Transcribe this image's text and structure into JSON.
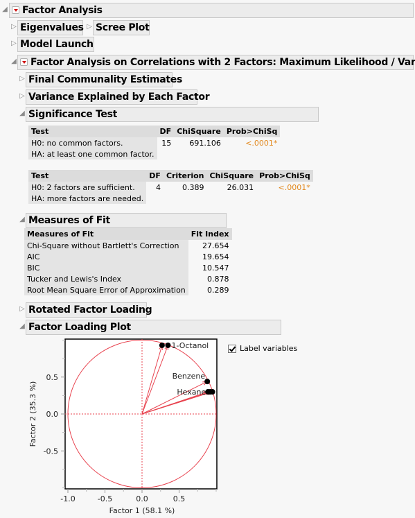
{
  "outline": {
    "root": {
      "title": "Factor Analysis",
      "state": "open"
    },
    "eigenvalues": {
      "title": "Eigenvalues",
      "state": "closed"
    },
    "scree_plot": {
      "title": "Scree Plot",
      "state": "closed"
    },
    "model_launch": {
      "title": "Model Launch",
      "state": "closed"
    },
    "fa_report": {
      "title": "Factor Analysis on Correlations with 2 Factors: Maximum Likelihood / Varimax",
      "state": "open"
    },
    "final_communality": {
      "title": "Final Communality Estimates",
      "state": "closed"
    },
    "variance_explained": {
      "title": "Variance Explained by Each Factor",
      "state": "closed"
    },
    "significance_test": {
      "title": "Significance Test",
      "state": "open"
    },
    "measures_of_fit": {
      "title": "Measures of Fit",
      "state": "open"
    },
    "rotated_loading": {
      "title": "Rotated Factor Loading",
      "state": "closed"
    },
    "loading_plot": {
      "title": "Factor Loading Plot",
      "state": "open"
    }
  },
  "sig_table1": {
    "headers": [
      "Test",
      "DF",
      "ChiSquare",
      "Prob>ChiSq"
    ],
    "rows": [
      {
        "test": "H0: no common factors.",
        "df": "15",
        "chisq": "691.106",
        "prob": "<.0001*"
      },
      {
        "test": "HA: at least one common factor.",
        "df": "",
        "chisq": "",
        "prob": ""
      }
    ]
  },
  "sig_table2": {
    "headers": [
      "Test",
      "DF",
      "Criterion",
      "ChiSquare",
      "Prob>ChiSq"
    ],
    "rows": [
      {
        "test": "H0: 2 factors are sufficient.",
        "df": "4",
        "criterion": "0.389",
        "chisq": "26.031",
        "prob": "<.0001*"
      },
      {
        "test": "HA: more factors are needed.",
        "df": "",
        "criterion": "",
        "chisq": "",
        "prob": ""
      }
    ]
  },
  "fit_table": {
    "headers": [
      "Measures of Fit",
      "Fit Index"
    ],
    "rows": [
      {
        "measure": "Chi-Square without Bartlett's Correction",
        "value": "27.654"
      },
      {
        "measure": "AIC",
        "value": "19.654"
      },
      {
        "measure": "BIC",
        "value": "10.547"
      },
      {
        "measure": "Tucker and Lewis's Index",
        "value": "0.878"
      },
      {
        "measure": "Root Mean Square Error of Approximation",
        "value": "0.289"
      }
    ]
  },
  "label_variables": {
    "label": "Label variables",
    "checked": true
  },
  "colors": {
    "accent_red": "#e8434f",
    "orange_pvalue": "#e2891f"
  },
  "chart_data": {
    "type": "scatter",
    "title": "Factor Loading Plot",
    "xlabel": "Factor 1  (58.1 %)",
    "ylabel": "Factor 2  (35.3 %)",
    "xlim": [
      -1.05,
      1.0
    ],
    "ylim": [
      -1.02,
      1.02
    ],
    "x_ticks": [
      -1.0,
      -0.5,
      0.0,
      0.5
    ],
    "y_ticks": [
      -0.5,
      0.0,
      0.5
    ],
    "x_tick_labels": [
      "-1.0",
      "-0.5",
      "0.0",
      "0.5"
    ],
    "y_tick_labels": [
      "-0.5",
      "0.0",
      "0.5"
    ],
    "unit_circle": true,
    "reference_lines": [
      0,
      0
    ],
    "points": [
      {
        "label": "",
        "x": 0.27,
        "y": 0.93
      },
      {
        "label": "1-Octanol",
        "x": 0.35,
        "y": 0.93
      },
      {
        "label": "Benzene",
        "x": 0.88,
        "y": 0.44
      },
      {
        "label": "Hexane",
        "x": 0.89,
        "y": 0.3
      },
      {
        "label": "",
        "x": 0.92,
        "y": 0.3
      },
      {
        "label": "",
        "x": 0.95,
        "y": 0.3
      }
    ]
  }
}
